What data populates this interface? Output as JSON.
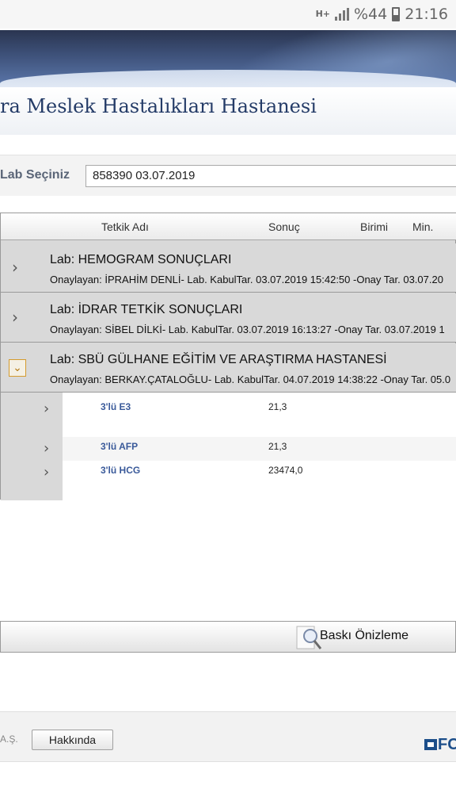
{
  "status_bar": {
    "network": "H+",
    "battery": "%44",
    "time": "21:16"
  },
  "header": {
    "hospital_title": "ra Meslek Hastalıkları Hastanesi"
  },
  "lab_select": {
    "label": "Lab Seçiniz",
    "value": "858390 03.07.2019"
  },
  "grid": {
    "columns": [
      "Tetkik Adı",
      "Sonuç",
      "Birimi",
      "Min."
    ],
    "groups": [
      {
        "title": "Lab: HEMOGRAM SONUÇLARI",
        "subtitle": "Onaylayan: İPRAHİM DENLİ- Lab. KabulTar. 03.07.2019 15:42:50 -Onay Tar. 03.07.20",
        "expanded": false
      },
      {
        "title": "Lab: İDRAR TETKİK SONUÇLARI",
        "subtitle": "Onaylayan: SİBEL DİLKİ- Lab. KabulTar. 03.07.2019 16:13:27 -Onay Tar. 03.07.2019 1",
        "expanded": false
      },
      {
        "title": "Lab: SBÜ GÜLHANE EĞİTİM VE ARAŞTIRMA HASTANESİ",
        "subtitle": "Onaylayan: BERKAY.ÇATALOĞLU- Lab. KabulTar. 04.07.2019 14:38:22 -Onay Tar. 05.0",
        "expanded": true
      }
    ],
    "details": [
      {
        "name": "3'lü E3",
        "value": "21,3"
      },
      {
        "name": "3'lü AFP",
        "value": "21,3"
      },
      {
        "name": "3'lü HCG",
        "value": "23474,0"
      }
    ]
  },
  "actions": {
    "preview_label": "Baskı Önizleme"
  },
  "footer": {
    "company_suffix": "A.Ş.",
    "about_label": "Hakkında",
    "logo_text": "FO"
  }
}
